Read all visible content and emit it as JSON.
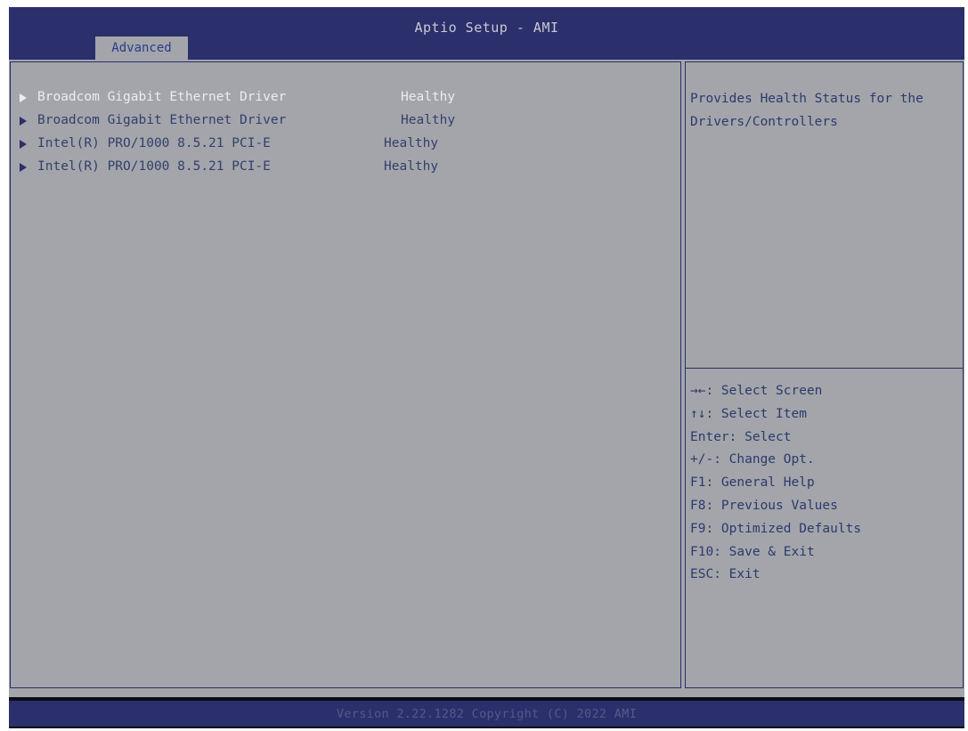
{
  "header": {
    "title": "Aptio Setup - AMI",
    "active_tab": "Advanced"
  },
  "drivers": [
    {
      "label": "Broadcom Gigabit Ethernet Driver",
      "status": "Healthy",
      "selected": true
    },
    {
      "label": "Broadcom Gigabit Ethernet Driver",
      "status": "Healthy",
      "selected": false
    },
    {
      "label": "Intel(R) PRO/1000 8.5.21 PCI-E",
      "status": "Healthy",
      "selected": false
    },
    {
      "label": "Intel(R) PRO/1000 8.5.21 PCI-E",
      "status": "Healthy",
      "selected": false
    }
  ],
  "help": {
    "description": "Provides Health Status for the Drivers/Controllers",
    "keys": [
      "→←: Select Screen",
      "↑↓: Select Item",
      "Enter: Select",
      "+/-: Change Opt.",
      "F1: General Help",
      "F8: Previous Values",
      "F9: Optimized Defaults",
      "F10: Save & Exit",
      "ESC: Exit"
    ]
  },
  "footer": {
    "text": "Version 2.22.1282 Copyright (C) 2022 AMI"
  },
  "colors": {
    "header_bg": "#2b2f6b",
    "panel_bg": "#a3a5aa",
    "text": "#33406d",
    "selected_text": "#ecedf2"
  }
}
